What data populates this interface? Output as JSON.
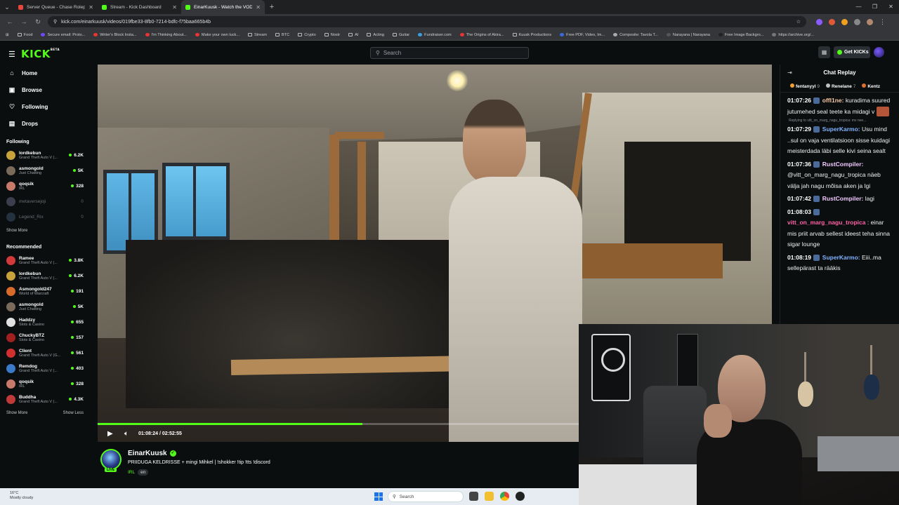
{
  "browser": {
    "tabs": [
      {
        "title": "Server Queue - Chase Roleplay",
        "color": "#e8453c",
        "active": false
      },
      {
        "title": "Stream - Kick Dashboard",
        "color": "#53fc18",
        "active": false
      },
      {
        "title": "EinarKuusk - Watch the VOD o",
        "color": "#53fc18",
        "active": true
      }
    ],
    "url": "kick.com/einarkuusk/videos/019fbe33-8fb0-7214-bdfc-f75baa665b4b",
    "bookmarks": [
      "Food",
      "Secure email: Proto...",
      "Writer's Block Insta...",
      "I'm Thinking About...",
      "Make your own luck...",
      "Stream",
      "BTC",
      "Crypto",
      "Nostr",
      "AI",
      "Acting",
      "Guitar",
      "Fundraiser.com",
      "The Origins of Akira...",
      "Kuusk Productions",
      "Free PDF, Video, Im...",
      "Composite: Tavola T...",
      "Narayana | Narayana",
      "Free Image Backgro...",
      "https://archive.org/..."
    ]
  },
  "header": {
    "logo": "KICK",
    "logo_badge": "BETA",
    "search_placeholder": "Search",
    "get_kicks": "Get KICKs"
  },
  "sidebar": {
    "nav": [
      {
        "label": "Home",
        "icon": "⌂"
      },
      {
        "label": "Browse",
        "icon": "▣"
      },
      {
        "label": "Following",
        "icon": "♡"
      },
      {
        "label": "Drops",
        "icon": "▤"
      }
    ],
    "following_title": "Following",
    "following": [
      {
        "name": "lordkebun",
        "category": "Grand Theft Auto V (...",
        "viewers": "6.2K",
        "color": "#c8a23a"
      },
      {
        "name": "asmongold",
        "category": "Just Chatting",
        "viewers": "5K",
        "color": "#7a6a5a"
      },
      {
        "name": "qoqsik",
        "category": "IRL",
        "viewers": "328",
        "color": "#c87a6a"
      },
      {
        "name": "metaversejoji",
        "category": "",
        "viewers": "",
        "color": "#8888aa"
      },
      {
        "name": "Legend_Rix",
        "category": "",
        "viewers": "",
        "color": "#4a6a8a"
      }
    ],
    "show_more": "Show More",
    "recommended_title": "Recommended",
    "recommended": [
      {
        "name": "Ramee",
        "category": "Grand Theft Auto V (...",
        "viewers": "3.8K",
        "color": "#d23a3a"
      },
      {
        "name": "lordkebun",
        "category": "Grand Theft Auto V (...",
        "viewers": "6.2K",
        "color": "#c8a23a"
      },
      {
        "name": "Asmongold247",
        "category": "World of Warcraft",
        "viewers": "191",
        "color": "#d86a2a"
      },
      {
        "name": "asmongold",
        "category": "Just Chatting",
        "viewers": "5K",
        "color": "#7a6a5a"
      },
      {
        "name": "Haddzy",
        "category": "Slots & Casino",
        "viewers": "655",
        "color": "#e0e0e0"
      },
      {
        "name": "ChuckyBTZ",
        "category": "Slots & Casino",
        "viewers": "157",
        "color": "#a02020"
      },
      {
        "name": "Client",
        "category": "Grand Theft Auto V (G...",
        "viewers": "561",
        "color": "#d03030"
      },
      {
        "name": "Remdog",
        "category": "Grand Theft Auto V (...",
        "viewers": "403",
        "color": "#3a7ac8"
      },
      {
        "name": "qoqsik",
        "category": "IRL",
        "viewers": "328",
        "color": "#c87a6a"
      },
      {
        "name": "Buddha",
        "category": "Grand Theft Auto V (...",
        "viewers": "4.3K",
        "color": "#c03a3a"
      }
    ],
    "show_more_2": "Show More",
    "show_less": "Show Less"
  },
  "player": {
    "time": "01:08:24 / 02:52:55",
    "progress": 0.55
  },
  "channel": {
    "name": "EinarKuusk",
    "live": "LIVE",
    "title": "PRIIDUGA KELDRISSE + mingi Mihkel | !shokker !tip !tts !discord",
    "category": "IRL",
    "language": "en"
  },
  "chat": {
    "title": "Chat Replay",
    "gifters": [
      {
        "name": "fentanyyl",
        "count": "9",
        "color": "#f0a030"
      },
      {
        "name": "Renelane",
        "count": "7",
        "color": "#c0c0c0"
      },
      {
        "name": "Kentz",
        "count": "",
        "color": "#e07030"
      }
    ],
    "messages": [
      {
        "time": "01:07:26",
        "user": "offl1ne:",
        "color": "#f7c9a5",
        "text": "kuradima suured jutumehed seal teete ka midagi v",
        "reply": "Replying to vitt_on_marg_nagu_tropica: mv nee..."
      },
      {
        "time": "01:07:29",
        "user": "SuperKarmo:",
        "color": "#7fb2ff",
        "text": "Usu mind ..sul on vaja ventilatsioon sisse kuidagi meisterdada läbi selle kivi seina sealt",
        "reply": ""
      },
      {
        "time": "01:07:36",
        "user": "RustCompiler:",
        "color": "#f0c7ff",
        "text": "@vitt_on_marg_nagu_tropica näeb välja jah nagu mõisa aken ja lgi",
        "reply": ""
      },
      {
        "time": "01:07:42",
        "user": "RustCompiler:",
        "color": "#f0c7ff",
        "text": "lagi",
        "reply": ""
      },
      {
        "time": "01:08:03",
        "user": "vitt_on_marg_nagu_tropica",
        "color": "#ff61a6",
        "text": ": einar mis priit arvab sellest ideest teha sinna sigar lounge",
        "reply": ""
      },
      {
        "time": "01:08:19",
        "user": "SuperKarmo:",
        "color": "#7fb2ff",
        "text": "Eiii..ma sellepärast ta räākis",
        "reply": ""
      }
    ]
  },
  "taskbar": {
    "temp": "16°C",
    "weather": "Mostly cloudy",
    "search": "Search"
  }
}
